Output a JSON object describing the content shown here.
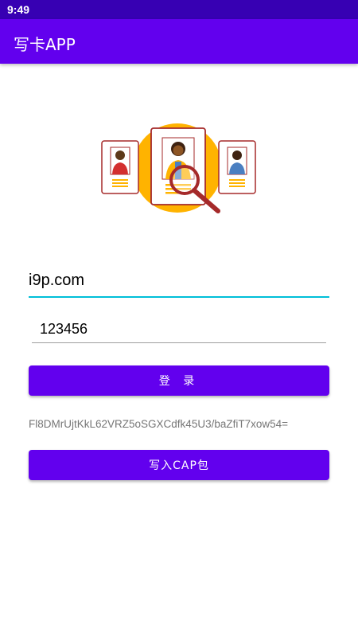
{
  "status_bar": {
    "time": "9:49"
  },
  "app_bar": {
    "title": "写卡APP"
  },
  "illustration": {
    "icon": "profile-search-illustration",
    "accent": "#FFB300",
    "frame": "#A52A2A"
  },
  "form": {
    "url_value": "i9p.com",
    "password_value": "123456",
    "login_label": "登 录",
    "result_text": "Fl8DMrUjtKkL62VRZ5oSGXCdfk45U3/baZfiT7xow54=",
    "write_cap_label": "写入CAP包"
  },
  "colors": {
    "primary": "#6200EE",
    "primary_dark": "#3700B3",
    "focus_underline": "#00BFD8"
  }
}
